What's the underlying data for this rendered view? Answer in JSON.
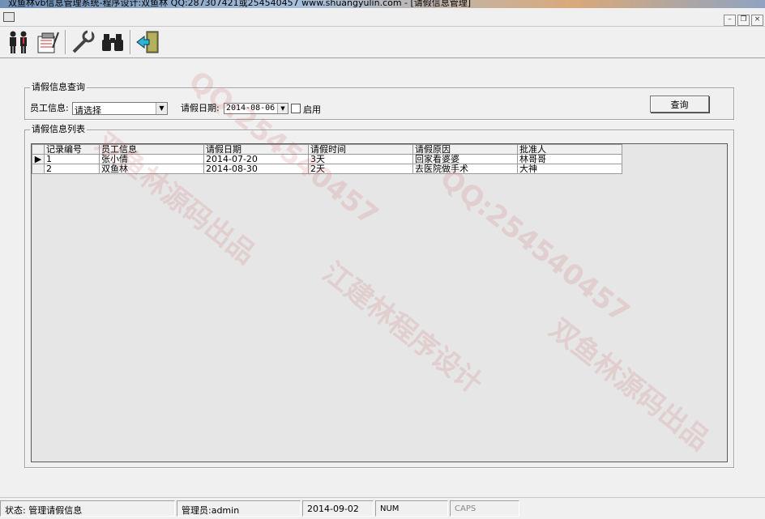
{
  "window": {
    "title": "双鱼林vb信息管理系统-程序设计:双鱼林 QQ:287307421或254540457 www.shuangyulin.com - [请假信息管理]"
  },
  "query_group": {
    "legend": "请假信息查询",
    "employee_label": "员工信息:",
    "employee_value": "请选择",
    "date_label": "请假日期:",
    "date_value": "2014-08-06",
    "enable_label": "启用",
    "query_button": "查询"
  },
  "list_group": {
    "legend": "请假信息列表",
    "columns": [
      "记录编号",
      "员工信息",
      "请假日期",
      "请假时间",
      "请假原因",
      "批准人"
    ],
    "rows": [
      [
        "1",
        "张小倩",
        "2014-07-20",
        "3天",
        "回家看婆婆",
        "林哥哥"
      ],
      [
        "2",
        "双鱼林",
        "2014-08-30",
        "2天",
        "去医院做手术",
        "大神"
      ]
    ]
  },
  "status": {
    "state": "状态: 管理请假信息",
    "user": "管理员:admin",
    "date": "2014-09-02",
    "num": "NUM",
    "caps": "CAPS"
  },
  "watermark": {
    "qq": "QQ:254540457",
    "author": "江建林程序设计",
    "source": "双鱼林源码出品"
  },
  "colors": {
    "window_bg": "#f0f0f0",
    "grid_bg": "#e6e6e6",
    "watermark": "#c85050"
  }
}
